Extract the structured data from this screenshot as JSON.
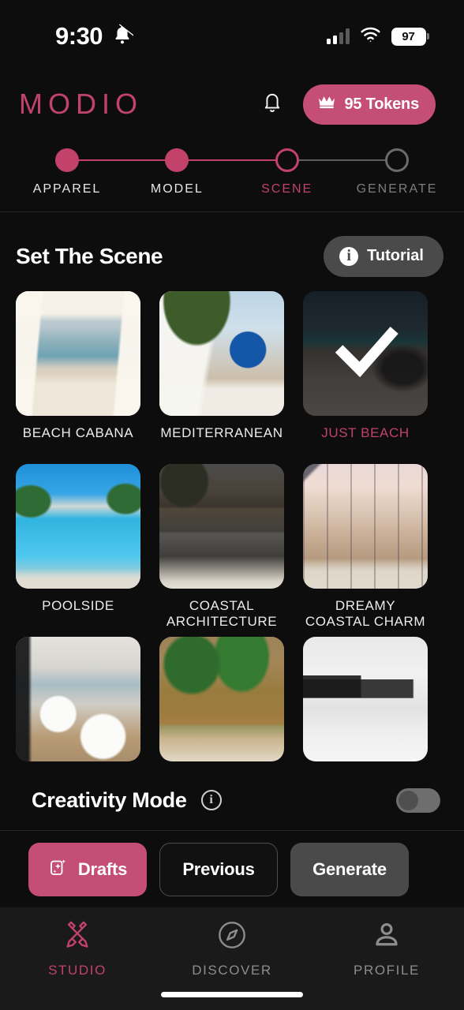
{
  "status_bar": {
    "time": "9:30",
    "silent_icon": "bell-slash-icon",
    "signal_icon": "cellular-signal-icon",
    "wifi_icon": "wifi-icon",
    "battery_level": "97"
  },
  "header": {
    "logo": "MODIO",
    "notifications_icon": "bell-icon",
    "tokens_label": "95 Tokens",
    "tokens_icon": "crown-icon",
    "accent_color": "#c2426b",
    "token_pill_color": "#c44e76"
  },
  "stepper": {
    "steps": [
      {
        "label": "APPAREL",
        "state": "done"
      },
      {
        "label": "MODEL",
        "state": "done"
      },
      {
        "label": "SCENE",
        "state": "active"
      },
      {
        "label": "GENERATE",
        "state": "todo"
      }
    ]
  },
  "section": {
    "title": "Set The Scene",
    "tutorial_label": "Tutorial",
    "tutorial_icon": "info-icon"
  },
  "scenes": [
    {
      "label": "BEACH CABANA",
      "art": "a-cabana",
      "selected": false
    },
    {
      "label": "MEDITERRANEAN",
      "art": "a-med",
      "selected": false
    },
    {
      "label": "JUST BEACH",
      "art": "a-beach",
      "selected": true
    },
    {
      "label": "POOLSIDE",
      "art": "a-pool",
      "selected": false
    },
    {
      "label": "COASTAL ARCHITECTURE",
      "art": "a-arch",
      "selected": false
    },
    {
      "label": "DREAMY COASTAL CHARM",
      "art": "a-charm",
      "selected": false
    },
    {
      "label": "",
      "art": "a-villa",
      "selected": false
    },
    {
      "label": "",
      "art": "a-palms",
      "selected": false
    },
    {
      "label": "",
      "art": "a-gal",
      "selected": false
    }
  ],
  "creativity": {
    "title": "Creativity Mode",
    "info_icon": "info-outline-icon",
    "toggle_state": "off"
  },
  "actions": {
    "drafts_label": "Drafts",
    "drafts_icon": "sparkle-frame-icon",
    "previous_label": "Previous",
    "generate_label": "Generate"
  },
  "tabbar": {
    "tabs": [
      {
        "label": "STUDIO",
        "icon": "brush-pen-cross-icon",
        "active": true
      },
      {
        "label": "DISCOVER",
        "icon": "compass-icon",
        "active": false
      },
      {
        "label": "PROFILE",
        "icon": "person-icon",
        "active": false
      }
    ]
  }
}
